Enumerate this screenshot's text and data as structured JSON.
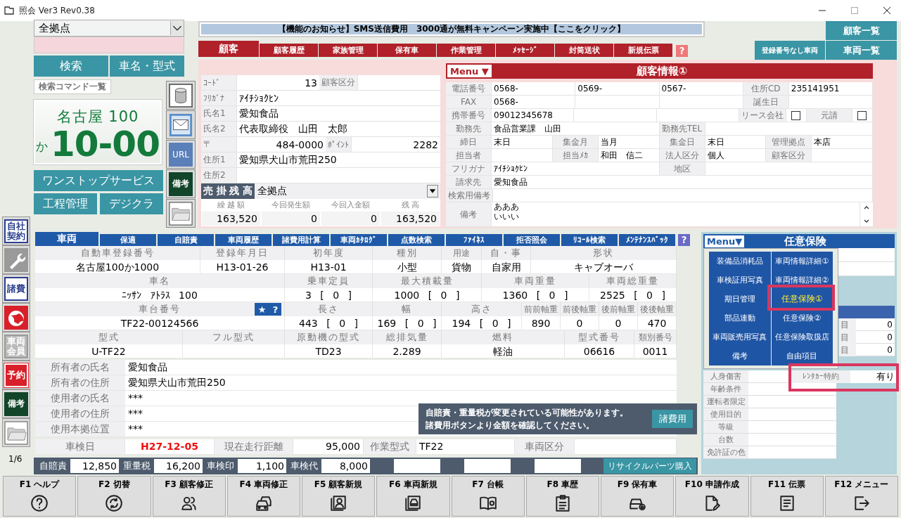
{
  "window": {
    "title": "照会 Ver3 Rev0.38"
  },
  "branch_select": {
    "value": "全拠点"
  },
  "search_buttons": [
    "検索",
    "車名・型式"
  ],
  "command_list_button": "検索コマンド一覧",
  "plate": {
    "region": "名古屋 100",
    "kana": "か",
    "number": "10-00"
  },
  "service_buttons": [
    "ワンストップサービス",
    "工程管理",
    "デジクラ"
  ],
  "side_icons": [
    {
      "kind": "database"
    },
    {
      "kind": "mail"
    },
    {
      "kind": "url",
      "text": "URL"
    },
    {
      "kind": "note",
      "text": "備考"
    },
    {
      "kind": "folder"
    }
  ],
  "notice": "【機能のお知らせ】SMS送信費用　3000通が無料キャンペーン実施中【ここをクリック】",
  "customer_tabs": [
    {
      "label": "顧客",
      "selected": true
    },
    {
      "label": "顧客履歴",
      "selected": false
    },
    {
      "label": "家族管理",
      "selected": false
    },
    {
      "label": "保有車",
      "selected": false
    },
    {
      "label": "作業管理",
      "selected": false
    },
    {
      "label": "ﾒｯｾｰｼﾞ",
      "selected": false
    },
    {
      "label": "封筒送状",
      "selected": false
    },
    {
      "label": "新規伝票",
      "selected": false
    }
  ],
  "customer_help": "?",
  "list_buttons": [
    "顧客一覧",
    "登録番号なし車両",
    "車両一覧"
  ],
  "customer_card": {
    "rows": [
      {
        "cells": [
          {
            "kind": "label",
            "text": "ｺｰﾄﾞ"
          },
          {
            "kind": "num",
            "text": "13"
          },
          {
            "kind": "label",
            "text": "顧客区分"
          },
          {
            "kind": "value"
          }
        ]
      },
      {
        "cells": [
          {
            "kind": "label",
            "text": "ﾌﾘｶﾞﾅ"
          },
          {
            "kind": "value",
            "text": "ｱｲﾁｼｮｸﾋﾝ"
          }
        ]
      },
      {
        "cells": [
          {
            "kind": "label",
            "text": "氏名1"
          },
          {
            "kind": "value",
            "text": "愛知食品"
          }
        ]
      },
      {
        "cells": [
          {
            "kind": "label",
            "text": "氏名2"
          },
          {
            "kind": "value",
            "text": "代表取締役　山田　太郎"
          }
        ]
      },
      {
        "cells": [
          {
            "kind": "label",
            "text": "〒"
          },
          {
            "kind": "num",
            "text": "484-0000"
          },
          {
            "kind": "label",
            "text": "ﾎﾟｲﾝﾄ"
          },
          {
            "kind": "num",
            "text": "2282"
          }
        ]
      },
      {
        "cells": [
          {
            "kind": "label",
            "text": "住所1"
          },
          {
            "kind": "value",
            "text": "愛知県犬山市荒田250"
          }
        ]
      },
      {
        "cells": [
          {
            "kind": "label",
            "text": "住所2"
          },
          {
            "kind": "value"
          }
        ]
      }
    ],
    "balance": {
      "title": "売 掛 残 高",
      "branch": "全拠点",
      "columns": [
        "繰 越 額",
        "今回発生額",
        "今回入金額",
        "残 高"
      ],
      "values": [
        "163,520",
        "0",
        "0",
        "163,520"
      ]
    }
  },
  "customer_info": {
    "menu": "Menu ▼",
    "title": "顧客情報①",
    "rows": [
      {
        "fields": [
          {
            "kind": "multi",
            "label": "電話番号",
            "values": [
              "0568-",
              "0569-",
              "0567-"
            ]
          },
          {
            "kind": "single",
            "label": "住所CD",
            "value": "235141951"
          }
        ]
      },
      {
        "fields": [
          {
            "kind": "multi",
            "label": "FAX",
            "values": [
              "0568-"
            ]
          },
          {
            "kind": "single",
            "label": "誕生日"
          }
        ]
      },
      {
        "fields": [
          {
            "kind": "multi",
            "label": "携帯番号",
            "values": [
              "09012345678"
            ]
          },
          {
            "kind": "check",
            "label": "リース会社",
            "checked": false
          },
          {
            "kind": "check",
            "label": "元請",
            "checked": false
          }
        ]
      },
      {
        "fields": [
          {
            "kind": "single",
            "label": "勤務先",
            "value": "食品営業課　山田"
          },
          {
            "kind": "single",
            "label": "勤務先TEL"
          }
        ]
      },
      {
        "fields": [
          {
            "kind": "single",
            "label": "締日",
            "value": "末日"
          },
          {
            "kind": "single",
            "label": "集金月",
            "value": "当月"
          },
          {
            "kind": "single",
            "label": "集金日",
            "value": "末日"
          },
          {
            "kind": "single",
            "label": "管理拠点",
            "value": "本店"
          }
        ]
      },
      {
        "fields": [
          {
            "kind": "single",
            "label": "担当者"
          },
          {
            "kind": "single",
            "label": "担当ﾒｶ",
            "value": "和田　信二"
          },
          {
            "kind": "single",
            "label": "法人区分",
            "value": "個人"
          },
          {
            "kind": "single",
            "label": "顧客区分"
          }
        ]
      },
      {
        "fields": [
          {
            "kind": "single",
            "label": "フリガナ",
            "value": "ｱｲﾁｼｮｸﾋﾝ"
          },
          {
            "kind": "single",
            "label": "地区"
          }
        ]
      },
      {
        "fields": [
          {
            "kind": "single",
            "label": "請求先",
            "value": "愛知食品"
          }
        ]
      },
      {
        "fields": [
          {
            "kind": "single",
            "label": "検索用備考"
          }
        ]
      }
    ],
    "remarks": {
      "label": "備考",
      "lines": [
        "あああ",
        "いいい"
      ]
    }
  },
  "rail": [
    {
      "kind": "box-text",
      "text": "自社契約"
    },
    {
      "kind": "wrench"
    },
    {
      "kind": "box-text",
      "text": "諸費"
    },
    {
      "kind": "globe"
    },
    {
      "kind": "grey-text",
      "text": "車両会員"
    },
    {
      "kind": "red-text",
      "text": "予約"
    },
    {
      "kind": "note",
      "text": "備考"
    },
    {
      "kind": "folder"
    }
  ],
  "page_indicator": "1/6",
  "vehicle": {
    "tabs": [
      {
        "label": "車両",
        "selected": true
      },
      {
        "label": "保適",
        "selected": false
      },
      {
        "label": "自賠責",
        "selected": false
      },
      {
        "label": "車両履歴",
        "selected": false
      },
      {
        "label": "諸費用計算",
        "selected": false
      },
      {
        "label": "車両ｶﾀﾛｸﾞ",
        "selected": false
      },
      {
        "label": "点数検索",
        "selected": false
      },
      {
        "label": "ﾌｧｲﾈｽ",
        "selected": false
      },
      {
        "label": "拒否照会",
        "selected": false
      },
      {
        "label": "ﾘｺｰﾙ検索",
        "selected": false
      },
      {
        "label": "ﾒﾝﾃﾅﾝｽﾊﾟｯｸ",
        "selected": false
      }
    ],
    "help": "?",
    "grid": [
      {
        "columns": [
          {
            "label": "自動車登録番号",
            "value": "名古屋100か1000"
          },
          {
            "label": "登録年月日",
            "value": "H13-01-26"
          },
          {
            "label": "初年度",
            "value": "H13-01"
          },
          {
            "label": "種別",
            "value": "小型"
          },
          {
            "label": "用途",
            "value": "貨物"
          },
          {
            "label": "自・事",
            "value": "自家用"
          },
          {
            "label": "形状",
            "value": "キャブオーバ"
          }
        ]
      },
      {
        "columns": [
          {
            "label": "車名",
            "value": "ﾆｯｻﾝ ｱﾄﾗｽ 100"
          },
          {
            "label": "乗車定員",
            "value": "3 [ 0 ]"
          },
          {
            "label": "最大積載量",
            "value": "1000 [ 0 ]"
          },
          {
            "label": "車両重量",
            "value": "1360 [ 0 ]"
          },
          {
            "label": "車両総重量",
            "value": "2525 [ 0 ]"
          }
        ]
      },
      {
        "columns": [
          {
            "label": "車台番号",
            "value": "TF22-00124566"
          },
          {
            "label": "長さ",
            "value": "443 [ 0 ]"
          },
          {
            "label": "幅",
            "value": "169 [ 0 ]"
          },
          {
            "label": "高さ",
            "value": "194 [ 0 ]"
          },
          {
            "label": "前前軸重",
            "value": "890"
          },
          {
            "label": "前後軸重",
            "value": "0"
          },
          {
            "label": "後前軸重",
            "value": "0"
          },
          {
            "label": "後後軸重",
            "value": "470"
          }
        ]
      },
      {
        "columns": [
          {
            "label": "型式",
            "value": "U-TF22"
          },
          {
            "label": "フル型式"
          },
          {
            "label": "原動機の型式",
            "value": "TD23"
          },
          {
            "label": "総排気量",
            "value": "2.289"
          },
          {
            "label": "燃料",
            "value": "軽油"
          },
          {
            "label": "型式番号",
            "value": "06616"
          },
          {
            "label": "類別番号",
            "value": "0011"
          }
        ]
      }
    ],
    "badge_star": "★",
    "badge_help": "?",
    "owner_rows": [
      {
        "label": "所有者の氏名",
        "value": "愛知食品"
      },
      {
        "label": "所有者の住所",
        "value": "愛知県犬山市荒田250"
      },
      {
        "label": "使用者の氏名",
        "value": "***"
      },
      {
        "label": "使用者の住所",
        "value": "***"
      },
      {
        "label": "使用本拠位置",
        "value": "***"
      }
    ],
    "alert": {
      "lines": [
        "自賠責・重量税が変更されている可能性があります。",
        "諸費用ボタンより金額を確認してください。"
      ],
      "button": "諸費用"
    },
    "inspection": [
      {
        "kind": "label",
        "text": "車検日"
      },
      {
        "kind": "date",
        "text": "H27-12-05"
      },
      {
        "kind": "label",
        "text": "現在走行距離"
      },
      {
        "kind": "num",
        "text": "95,000"
      },
      {
        "kind": "label",
        "text": "作業型式"
      },
      {
        "kind": "value",
        "text": "TF22"
      },
      {
        "kind": "label",
        "text": "車両区分"
      },
      {
        "kind": "value"
      }
    ],
    "fees": [
      {
        "label": "自賠責",
        "value": "12,850"
      },
      {
        "label": "重量税",
        "value": "16,200"
      },
      {
        "label": "車検印",
        "value": "1,100"
      },
      {
        "label": "車検代",
        "value": "8,000"
      }
    ],
    "recycle_button": "リサイクルパーツ購入"
  },
  "insurance": {
    "menu": "Menu▼",
    "title": "任意保険",
    "side_rows": [
      {
        "label": "目",
        "value": "0"
      },
      {
        "label": "目",
        "value": "0"
      },
      {
        "label": "目",
        "value": "0"
      }
    ],
    "rider": {
      "label": "ﾚﾝﾀｶｰ特約",
      "value": "有り"
    },
    "rows": [
      "人身傷害",
      "年齢条件",
      "運転者限定",
      "使用目的",
      "等級",
      "台数",
      "免許証の色"
    ],
    "popup": [
      {
        "label": "装備品消耗品",
        "selected": false
      },
      {
        "label": "車検証用写真",
        "selected": false
      },
      {
        "label": "期日管理",
        "selected": false
      },
      {
        "label": "部品連動",
        "selected": false
      },
      {
        "label": "車両販売用写真",
        "selected": false
      },
      {
        "label": "備考",
        "selected": false
      },
      {
        "label": "車両情報詳細①",
        "selected": false
      },
      {
        "label": "車両情報詳細②",
        "selected": false
      },
      {
        "label": "任意保険①",
        "selected": true
      },
      {
        "label": "任意保険②",
        "selected": false
      },
      {
        "label": "任意保険取扱店",
        "selected": false
      },
      {
        "label": "自由項目",
        "selected": false
      }
    ]
  },
  "function_keys": [
    {
      "label": "F1 ヘルプ",
      "kind": "help"
    },
    {
      "label": "F2 切替",
      "kind": "sync"
    },
    {
      "label": "F3 顧客修正",
      "kind": "people"
    },
    {
      "label": "F4 車両修正",
      "kind": "cars"
    },
    {
      "label": "F5 顧客新規",
      "kind": "profile"
    },
    {
      "label": "F6 車両新規",
      "kind": "car-card"
    },
    {
      "label": "F7 台帳",
      "kind": "book"
    },
    {
      "label": "F8 車歴",
      "kind": "clipboard"
    },
    {
      "label": "F9 保有車",
      "kind": "car-person"
    },
    {
      "label": "F10 申請作成",
      "kind": "doc-edit"
    },
    {
      "label": "F11 伝票",
      "kind": "list"
    },
    {
      "label": "F12 メニュー",
      "kind": "exit"
    }
  ]
}
